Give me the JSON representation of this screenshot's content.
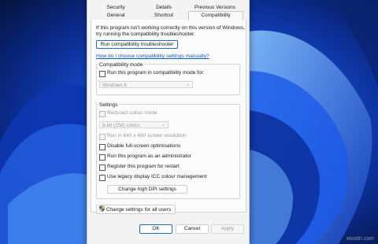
{
  "tabs_row1": [
    {
      "label": "Security"
    },
    {
      "label": "Details"
    },
    {
      "label": "Previous Versions"
    }
  ],
  "tabs_row2": [
    {
      "label": "General"
    },
    {
      "label": "Shortcut"
    },
    {
      "label": "Compatibility",
      "active": true
    }
  ],
  "intro": {
    "line1": "If this program isn't working correctly on this version of Windows,",
    "line2": "try running the compatibility troubleshooter."
  },
  "troubleshooter_button": "Run compatibility troubleshooter",
  "manual_link": "How do I choose compatibility settings manually?",
  "compat_mode": {
    "title": "Compatibility mode",
    "checkbox_label": "Run this program in compatibility mode for:",
    "checked": false,
    "selected_os": "Windows 8"
  },
  "settings": {
    "title": "Settings",
    "reduced_colour_label": "Reduced colour mode",
    "colour_select": "8-bit (256) colour",
    "run_640_label": "Run in 640 x 480 screen resolution",
    "disable_fullscreen_label": "Disable full-screen optimisations",
    "run_admin_label": "Run this program as an administrator",
    "register_restart_label": "Register this program for restart",
    "legacy_icc_label": "Use legacy display ICC colour management",
    "high_dpi_button": "Change high DPI settings"
  },
  "all_users_button": "Change settings for all users",
  "footer": {
    "ok": "OK",
    "cancel": "Cancel",
    "apply": "Apply"
  },
  "watermark": "wsxdn.com",
  "colors": {
    "accent": "#0b5ccc",
    "wallpaper_base": "#0a1f5c",
    "wallpaper_bloom": "#1a5cf0"
  }
}
